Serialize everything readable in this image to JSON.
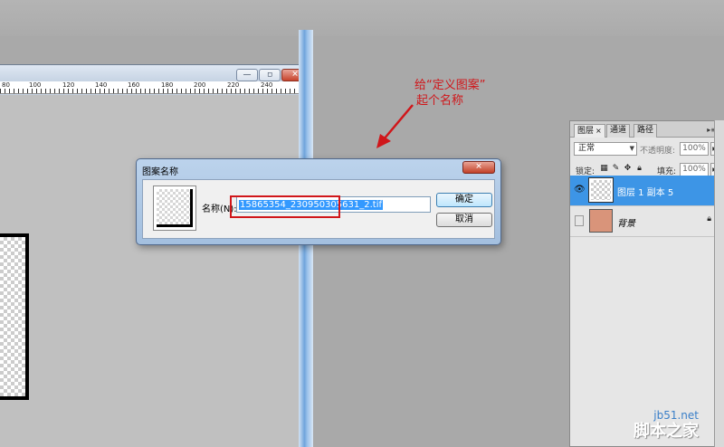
{
  "annotation": {
    "line1": "给“定义图案”",
    "line2": "起个名称"
  },
  "document_window": {
    "ruler_labels": [
      "80",
      "100",
      "120",
      "140",
      "160",
      "180",
      "200",
      "220",
      "240"
    ],
    "buttons": {
      "minimize": "—",
      "restore": "▫",
      "close": "✕"
    }
  },
  "dialog": {
    "title": "图案名称",
    "name_label": "名称(N):",
    "name_value": "15865354_230950305631_2.tif",
    "ok_label": "确定",
    "cancel_label": "取消",
    "close_glyph": "✕"
  },
  "layers_panel": {
    "tabs": [
      {
        "label": "图层",
        "close": "×"
      },
      {
        "label": "通道"
      },
      {
        "label": "路径"
      }
    ],
    "menu_glyph": "▸≡",
    "blend_mode": "正常",
    "opacity_label": "不透明度:",
    "opacity_value": "100%",
    "lock_label": "锁定:",
    "fill_label": "填充:",
    "fill_value": "100%",
    "layers": [
      {
        "name": "图层 1 副本 5",
        "selected": true,
        "visible": true
      },
      {
        "name": "背景",
        "selected": false,
        "visible": false,
        "locked": true
      }
    ],
    "colors": {
      "selected_row": "#3d95e6",
      "background_thumb": "#d9947a"
    }
  },
  "watermark": {
    "url": "jb51.net",
    "text": "脚本之家"
  },
  "colors": {
    "annotation_red": "#d0161a",
    "workspace_gray": "#a9a9a9",
    "selection_blue": "#3399ff"
  }
}
